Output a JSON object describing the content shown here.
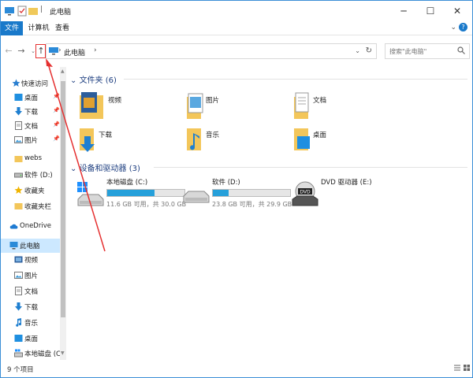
{
  "window": {
    "title": "此电脑"
  },
  "ribbon": {
    "tabs": [
      "文件",
      "计算机",
      "查看"
    ]
  },
  "address": {
    "path": "此电脑"
  },
  "search": {
    "placeholder": "搜索\"此电脑\""
  },
  "sidebar": {
    "items": [
      {
        "label": "快速访问",
        "icon": "star-icon"
      },
      {
        "label": "桌面",
        "icon": "desktop-icon"
      },
      {
        "label": "下载",
        "icon": "download-icon"
      },
      {
        "label": "文档",
        "icon": "document-icon"
      },
      {
        "label": "图片",
        "icon": "picture-icon"
      },
      {
        "label": "webs",
        "icon": "folder-icon"
      },
      {
        "label": "软件 (D:)",
        "icon": "drive-icon"
      },
      {
        "label": "收藏夹",
        "icon": "star-icon"
      },
      {
        "label": "收藏夹栏",
        "icon": "folder-icon"
      },
      {
        "label": "OneDrive",
        "icon": "cloud-icon"
      },
      {
        "label": "此电脑",
        "icon": "computer-icon"
      },
      {
        "label": "视频",
        "icon": "video-icon"
      },
      {
        "label": "图片",
        "icon": "picture-icon"
      },
      {
        "label": "文档",
        "icon": "document-icon"
      },
      {
        "label": "下载",
        "icon": "download-icon"
      },
      {
        "label": "音乐",
        "icon": "music-icon"
      },
      {
        "label": "桌面",
        "icon": "desktop-icon"
      },
      {
        "label": "本地磁盘 (C:)",
        "icon": "drive-icon"
      }
    ]
  },
  "main": {
    "folders_header": "文件夹 (6)",
    "folders": [
      {
        "label": "视频",
        "icon": "video-folder-icon"
      },
      {
        "label": "图片",
        "icon": "picture-folder-icon"
      },
      {
        "label": "文档",
        "icon": "document-folder-icon"
      },
      {
        "label": "下载",
        "icon": "download-folder-icon"
      },
      {
        "label": "音乐",
        "icon": "music-folder-icon"
      },
      {
        "label": "桌面",
        "icon": "desktop-folder-icon"
      }
    ],
    "drives_header": "设备和驱动器 (3)",
    "drives": [
      {
        "name": "本地磁盘 (C:)",
        "size": "11.6 GB 可用，共 30.0 GB",
        "used_fraction": 0.613,
        "icon": "windows-drive-icon"
      },
      {
        "name": "软件 (D:)",
        "size": "23.8 GB 可用，共 29.9 GB",
        "used_fraction": 0.204,
        "icon": "drive-icon"
      },
      {
        "name": "DVD 驱动器 (E:)",
        "icon": "dvd-drive-icon"
      }
    ]
  },
  "status": {
    "count": "9 个项目"
  },
  "colors": {
    "accent": "#1979ca",
    "selection": "#cce8ff",
    "header": "#1e3f80",
    "annotation": "#e53030",
    "drive_bar": "#26a0da"
  }
}
